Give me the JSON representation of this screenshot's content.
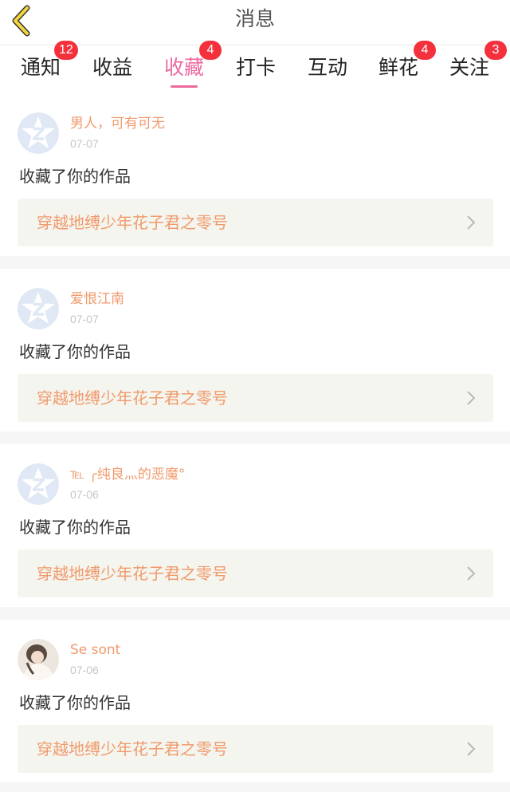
{
  "header": {
    "title": "消息",
    "back_icon": "chevron-left-icon"
  },
  "tabs": [
    {
      "label": "通知",
      "badge": "12",
      "active": false
    },
    {
      "label": "收益",
      "badge": "",
      "active": false
    },
    {
      "label": "收藏",
      "badge": "4",
      "active": true
    },
    {
      "label": "打卡",
      "badge": "",
      "active": false
    },
    {
      "label": "互动",
      "badge": "",
      "active": false
    },
    {
      "label": "鲜花",
      "badge": "4",
      "active": false
    },
    {
      "label": "关注",
      "badge": "3",
      "active": false
    }
  ],
  "notifications": [
    {
      "username": "男人，可有可无",
      "date": "07-07",
      "action": "收藏了你的作品",
      "work_title": "穿越地缚少年花子君之零号",
      "avatar": "default-avatar-icon"
    },
    {
      "username": "爱恨江南",
      "date": "07-07",
      "action": "收藏了你的作品",
      "work_title": "穿越地缚少年花子君之零号",
      "avatar": "default-avatar-icon"
    },
    {
      "username": "℡ ╭纯良灬的恶魔°",
      "date": "07-06",
      "action": "收藏了你的作品",
      "work_title": "穿越地缚少年花子君之零号",
      "avatar": "default-avatar-icon"
    },
    {
      "username": "Se sont",
      "date": "07-06",
      "action": "收藏了你的作品",
      "work_title": "穿越地缚少年花子君之零号",
      "avatar": "user-photo-avatar"
    }
  ],
  "colors": {
    "accent_pink": "#ec6aa0",
    "orange_text": "#f09a6c",
    "badge_red": "#f3303c",
    "back_arrow_yellow": "#f5d63a",
    "link_bg": "#f5f5ef"
  }
}
